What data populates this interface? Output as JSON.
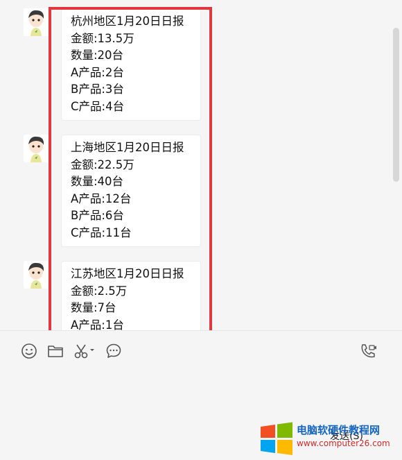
{
  "messages": [
    {
      "lines": [
        "杭州地区1月20日日报",
        "金额:13.5万",
        "数量:20台",
        "A产品:2台",
        "B产品:3台",
        "C产品:4台"
      ]
    },
    {
      "lines": [
        "上海地区1月20日日报",
        "金额:22.5万",
        "数量:40台",
        "A产品:12台",
        "B产品:6台",
        "C产品:11台"
      ]
    },
    {
      "lines": [
        "江苏地区1月20日日报",
        "金额:2.5万",
        "数量:7台",
        "A产品:1台"
      ]
    }
  ],
  "toolbar": {
    "icons": [
      "emoji-icon",
      "folder-icon",
      "scissors-icon",
      "chat-history-icon",
      "video-call-icon"
    ]
  },
  "send_button": {
    "label": "发送(S)"
  },
  "watermark": {
    "title": "电脑软硬件教程网",
    "url": "www.computer26.com"
  },
  "colors": {
    "highlight": "#e3373f",
    "background": "#f5f5f5",
    "bubble": "#ffffff"
  }
}
